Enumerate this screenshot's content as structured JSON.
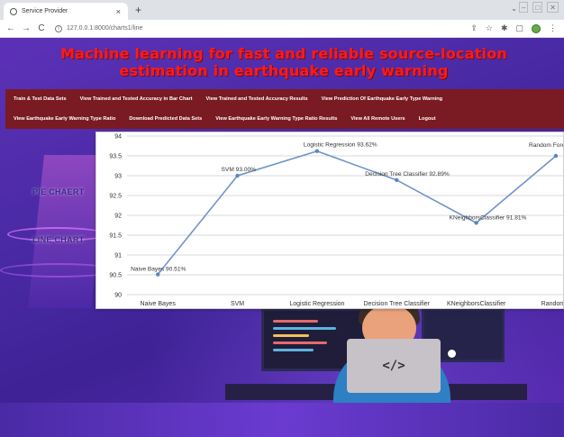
{
  "browser": {
    "tab_title": "Service Provider",
    "tab_close": "×",
    "new_tab": "+",
    "url": "127.0.0.1:8000/charts1/line",
    "nav": {
      "back": "←",
      "forward": "→",
      "reload": "C"
    },
    "right_icons": [
      "share-icon",
      "star-icon",
      "extensions-icon",
      "sidepanel-icon",
      "profile-icon",
      "menu-icon"
    ]
  },
  "page": {
    "title": "Machine learning for fast and reliable source-location estimation in earthquake early warning",
    "menu_row1": [
      "Train & Test Data Sets",
      "View Trained and Tested Accuracy in Bar Chart",
      "View Trained and Tested Accuracy Results",
      "View Prediction Of Earthquake Early Type Warning"
    ],
    "menu_row2": [
      "View Earthquake Early Warning Type Ratio",
      "Download Predicted Data Sets",
      "View Earthquake Early Warning Type Ratio Results",
      "View All Remote Users",
      "Logout"
    ],
    "side_links": {
      "pie": "PIE CHAERT",
      "line": "LINE CHART"
    },
    "laptop_glyph": "</>"
  },
  "colors": {
    "headline": "#ff1a1a",
    "menubar": "#7a1a22",
    "line": "#6f95c9",
    "point": "#5b85c0"
  },
  "chart_data": {
    "type": "line",
    "categories": [
      "Naive Bayes",
      "SVM",
      "Logistic Regression",
      "Decision Tree Classifier",
      "KNeighborsClassifier",
      "Random Forest Classifier"
    ],
    "tick_labels_x": [
      "Naive Bayes",
      "SVM",
      "Logistic Regression",
      "Decision Tree Classifier",
      "KNeighborsClassifier",
      "Random F"
    ],
    "values": [
      90.51,
      93.0,
      93.62,
      92.89,
      91.81,
      93.5
    ],
    "point_labels": [
      "Naive Bayes 90.51%",
      "SVM 93.00%",
      "Logistic Regression 93.62%",
      "Decision Tree Classifier 92.89%",
      "KNeighborsClassifier 91.81%",
      "Random Fore"
    ],
    "ylim": [
      90,
      94
    ],
    "yticks": [
      90,
      90.5,
      91,
      91.5,
      92,
      92.5,
      93,
      93.5,
      94
    ],
    "ytick_labels": [
      "90",
      "90.5",
      "91",
      "91.5",
      "92",
      "92.5",
      "93",
      "93.5",
      "94"
    ],
    "grid": true
  }
}
